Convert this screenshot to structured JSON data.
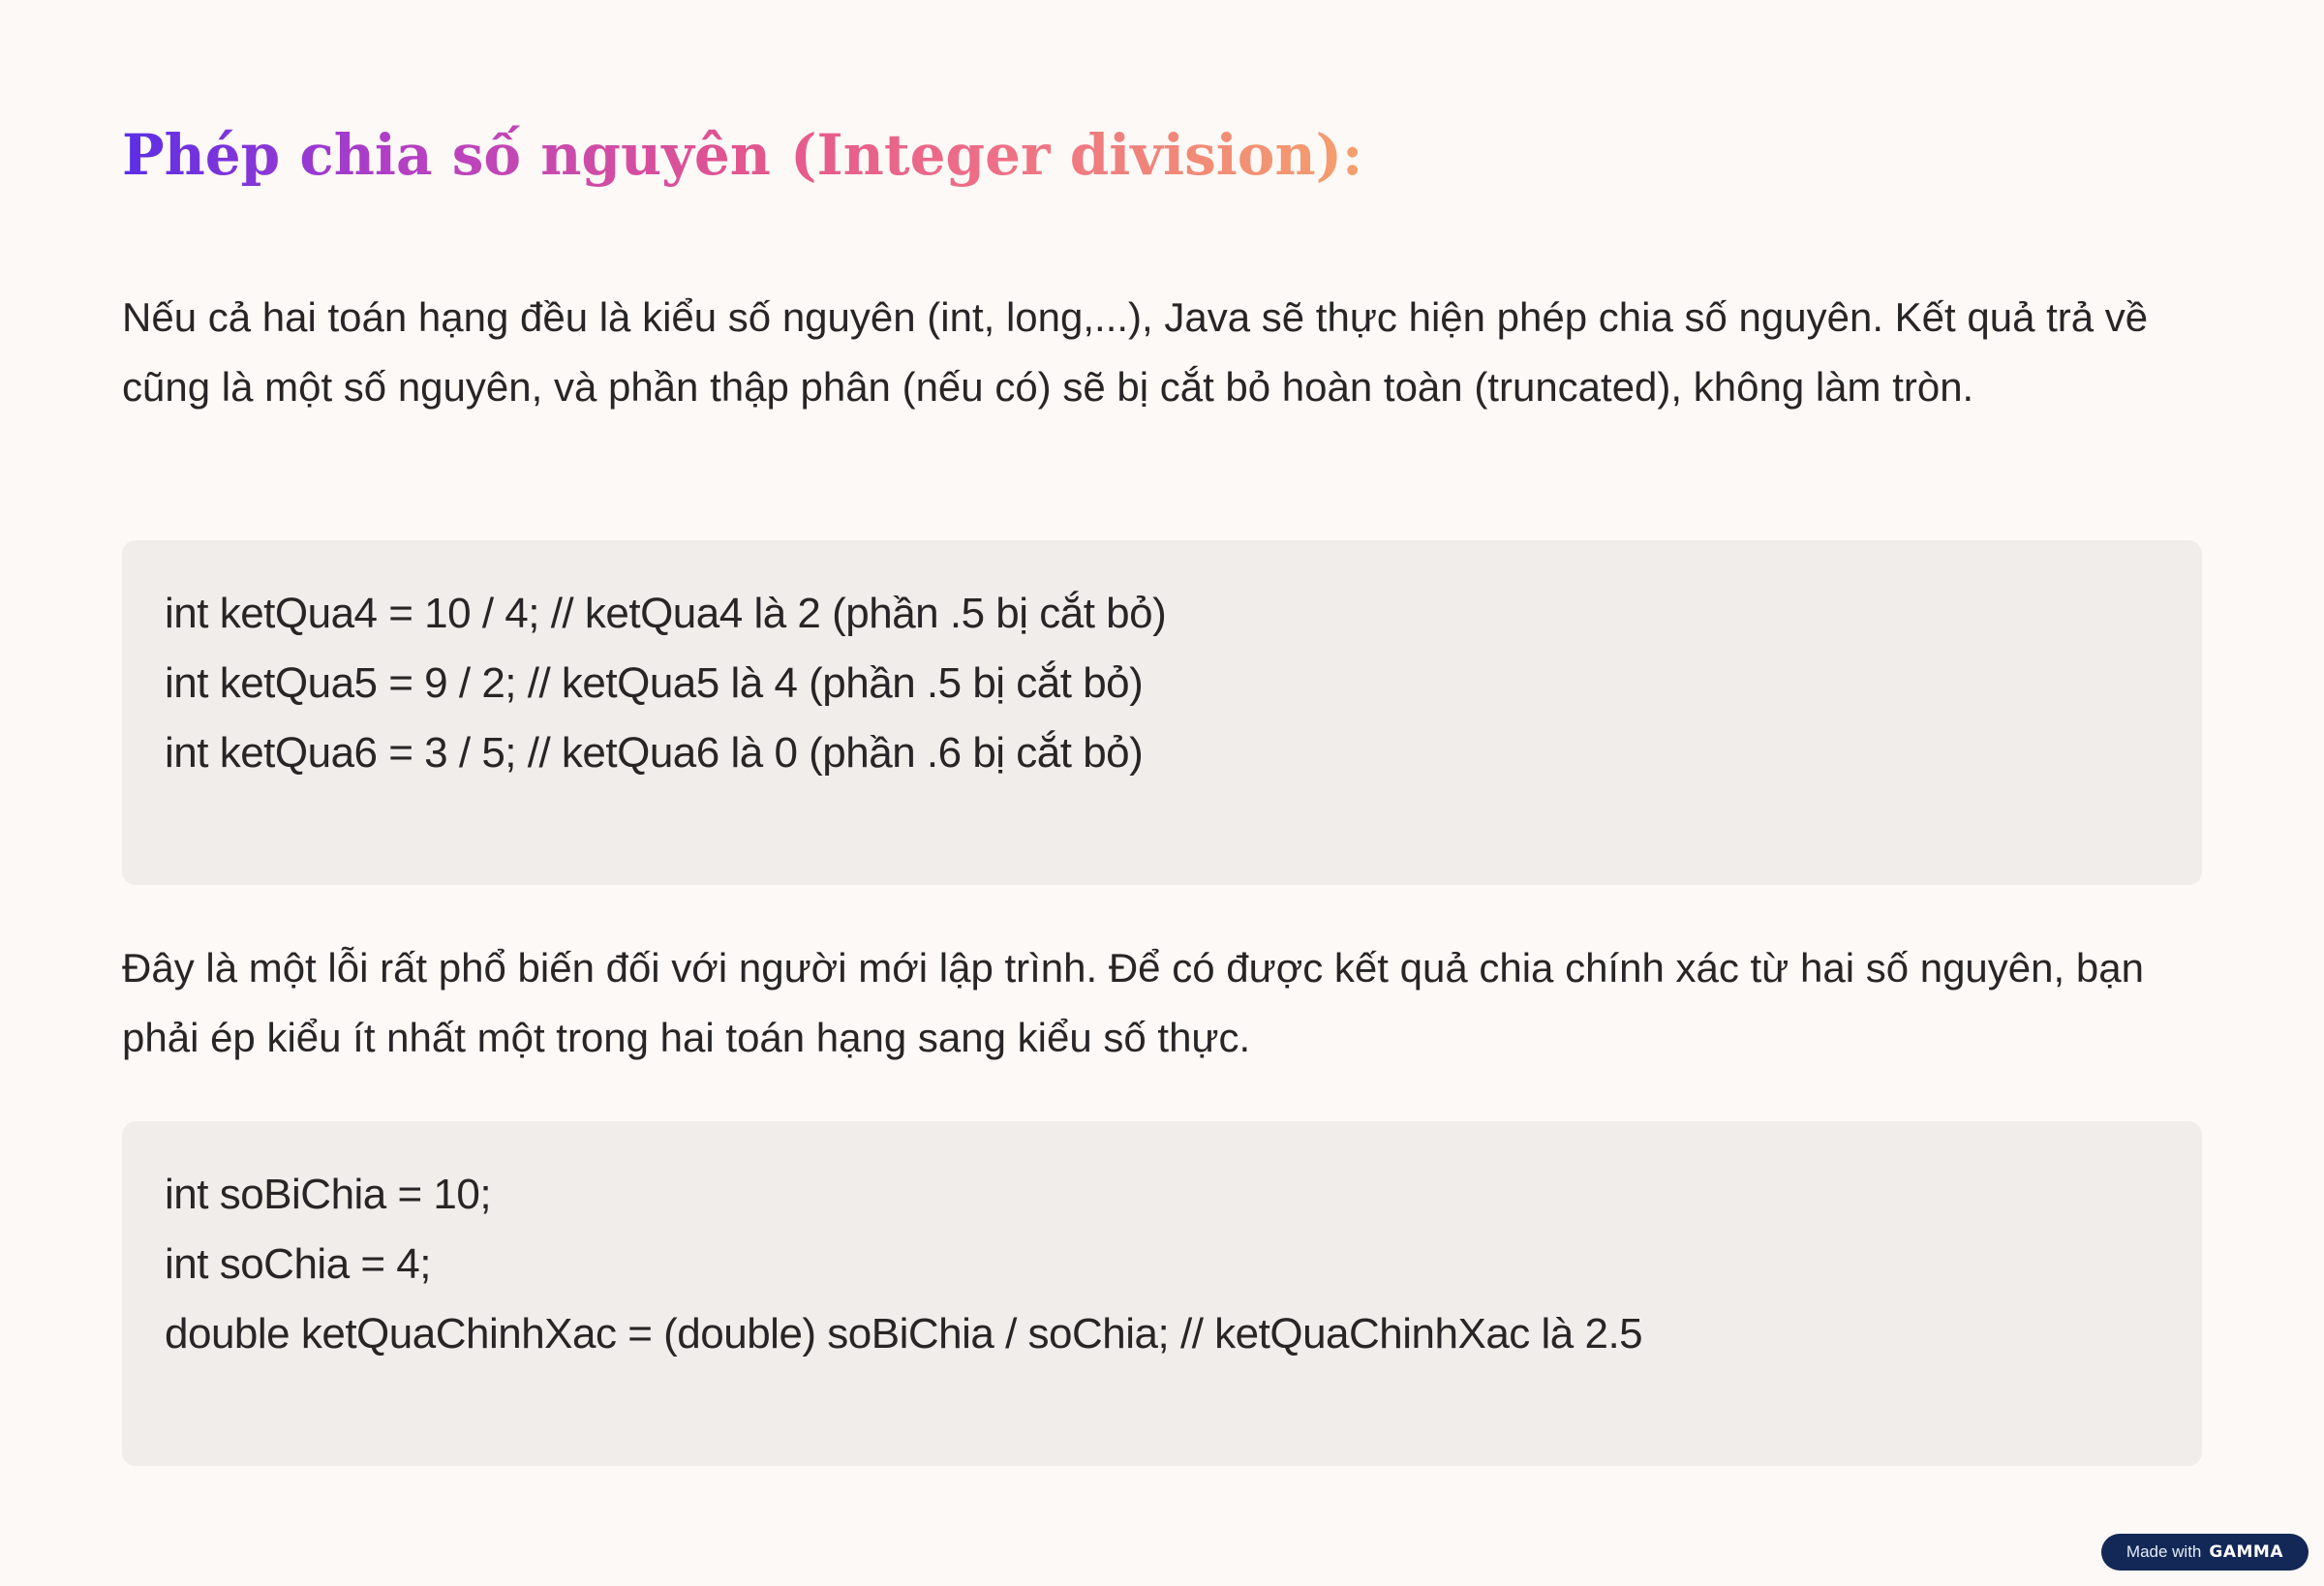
{
  "slide": {
    "title": "Phép chia số nguyên (Integer division):",
    "paragraph_1": "Nếu cả hai toán hạng đều là kiểu số nguyên (int, long,...), Java sẽ thực hiện phép chia số nguyên. Kết quả trả về cũng là một số nguyên, và phần thập phân (nếu có) sẽ bị cắt bỏ hoàn toàn (truncated), không làm tròn.",
    "code_block_1": [
      "int ketQua4 = 10 / 4; // ketQua4 là 2 (phần .5 bị cắt bỏ)",
      "int ketQua5 = 9 / 2; // ketQua5 là 4 (phần .5 bị cắt bỏ)",
      "int ketQua6 = 3 / 5; // ketQua6 là 0 (phần .6 bị cắt bỏ)"
    ],
    "paragraph_2": "Đây là một lỗi rất phổ biến đối với người mới lập trình. Để có được kết quả chia chính xác từ hai số nguyên, bạn phải ép kiểu ít nhất một trong hai toán hạng sang kiểu số thực.",
    "code_block_2": [
      "int soBiChia = 10;",
      "int soChia = 4;",
      "double ketQuaChinhXac = (double) soBiChia / soChia; // ketQuaChinhXac là 2.5"
    ]
  },
  "badge": {
    "prefix": "Made with",
    "brand": "GAMMA"
  },
  "colors": {
    "background": "#fcf9f6",
    "code_background": "#f0edea",
    "text": "#272525",
    "title_gradient": [
      "#5b2ee6",
      "#b33fc6",
      "#e2558f",
      "#ee6f86",
      "#f4a06c"
    ],
    "badge_background": "#132857"
  }
}
